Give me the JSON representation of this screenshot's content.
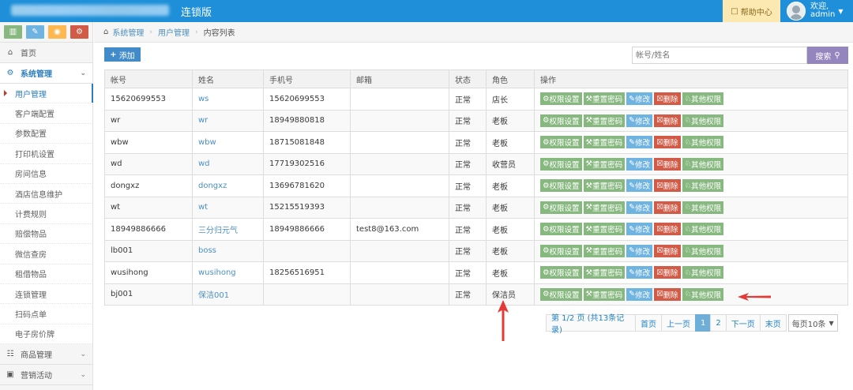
{
  "topbar": {
    "title": "连锁版",
    "help_label": "帮助中心",
    "welcome": "欢迎,",
    "user": "admin"
  },
  "sidebar": {
    "quick_icons": [
      "bar-chart-icon",
      "pencil-icon",
      "users-icon",
      "cogs-icon"
    ],
    "home": "首页",
    "system_group": "系统管理",
    "sub_items": [
      "用户管理",
      "客户端配置",
      "参数配置",
      "打印机设置",
      "房间信息",
      "酒店信息维护",
      "计费规则",
      "赔偿物品",
      "微信查房",
      "租借物品",
      "连锁管理",
      "扫码点单",
      "电子房价牌"
    ],
    "goods_group": "商品管理",
    "marketing_group": "营销活动"
  },
  "breadcrumb": {
    "root": "系统管理",
    "parent": "用户管理",
    "current": "内容列表"
  },
  "toolbar": {
    "add_label": "添加",
    "search_placeholder": "帐号/姓名",
    "search_label": "搜索"
  },
  "table": {
    "headers": [
      "帐号",
      "姓名",
      "手机号",
      "邮箱",
      "状态",
      "角色",
      "操作"
    ],
    "ops": [
      "权限设置",
      "重置密码",
      "修改",
      "删除",
      "其他权限"
    ],
    "rows": [
      {
        "account": "15620699553",
        "name": "ws",
        "phone": "15620699553",
        "email": "",
        "status": "正常",
        "role": "店长"
      },
      {
        "account": "wr",
        "name": "wr",
        "phone": "18949880818",
        "email": "",
        "status": "正常",
        "role": "老板"
      },
      {
        "account": "wbw",
        "name": "wbw",
        "phone": "18715081848",
        "email": "",
        "status": "正常",
        "role": "老板"
      },
      {
        "account": "wd",
        "name": "wd",
        "phone": "17719302516",
        "email": "",
        "status": "正常",
        "role": "收营员"
      },
      {
        "account": "dongxz",
        "name": "dongxz",
        "phone": "13696781620",
        "email": "",
        "status": "正常",
        "role": "老板"
      },
      {
        "account": "wt",
        "name": "wt",
        "phone": "15215519393",
        "email": "",
        "status": "正常",
        "role": "老板"
      },
      {
        "account": "18949886666",
        "name": "三分归元气",
        "phone": "18949886666",
        "email": "test8@163.com",
        "status": "正常",
        "role": "老板"
      },
      {
        "account": "lb001",
        "name": "boss",
        "phone": "",
        "email": "",
        "status": "正常",
        "role": "老板"
      },
      {
        "account": "wusihong",
        "name": "wusihong",
        "phone": "18256516951",
        "email": "",
        "status": "正常",
        "role": "老板"
      },
      {
        "account": "bj001",
        "name": "保洁001",
        "phone": "",
        "email": "",
        "status": "正常",
        "role": "保洁员"
      }
    ]
  },
  "pager": {
    "info": "第 1/2 页 (共13条记录)",
    "first": "首页",
    "prev": "上一页",
    "pages": [
      "1",
      "2"
    ],
    "current_page": "1",
    "next": "下一页",
    "last": "末页",
    "per_page": "每页10条"
  },
  "colors": {
    "topbar": "#1e8fd8",
    "green": "#87b87f",
    "blue": "#6fb3e0",
    "red": "#d15b47",
    "annotation_arrow": "#e53935"
  }
}
